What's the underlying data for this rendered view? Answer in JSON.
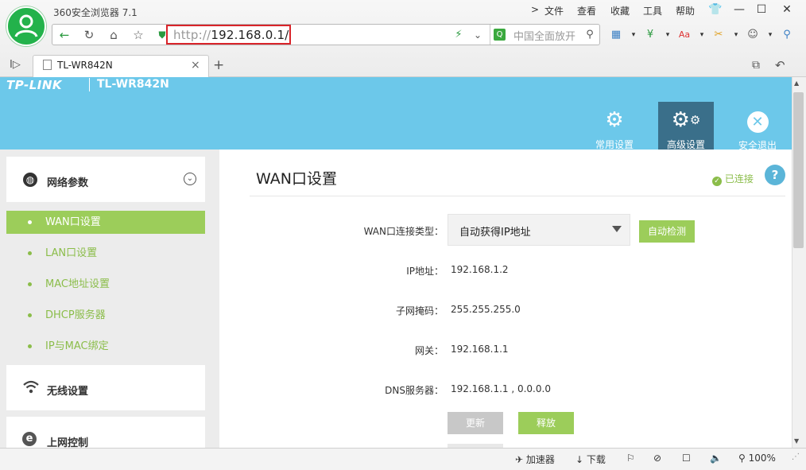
{
  "browser": {
    "app_title": "360安全浏览器 7.1",
    "menu": [
      "文件",
      "查看",
      "收藏",
      "工具",
      "帮助"
    ],
    "url_prefix": "http://",
    "url_host": "192.168.0.1/",
    "search_placeholder": "中国全面放开",
    "tab_title": "TL-WR842N",
    "tab_close": "×",
    "new_tab": "+",
    "status": {
      "accelerator": "加速器",
      "download": "下载",
      "zoom": "100%"
    }
  },
  "router": {
    "brand": "TP-LINK",
    "model": "TL-WR842N",
    "header_buttons": [
      {
        "label": "常用设置",
        "icon": "gear-icon"
      },
      {
        "label": "高级设置",
        "icon": "gears-icon"
      },
      {
        "label": "安全退出",
        "icon": "close-circle-icon"
      }
    ],
    "sidebar": {
      "sections": [
        {
          "label": "网络参数",
          "icon": "globe-icon"
        },
        {
          "label": "无线设置",
          "icon": "wifi-icon"
        },
        {
          "label": "上网控制",
          "icon": "ie-icon"
        }
      ],
      "subitems": [
        "WAN口设置",
        "LAN口设置",
        "MAC地址设置",
        "DHCP服务器",
        "IP与MAC绑定"
      ]
    },
    "main": {
      "title": "WAN口设置",
      "status": "已连接",
      "help": "?",
      "wan_type_label": "WAN口连接类型：",
      "wan_type_value": "自动获得IP地址",
      "detect_button": "自动检测",
      "ip_label": "IP地址：",
      "ip_value": "192.168.1.2",
      "mask_label": "子网掩码：",
      "mask_value": "255.255.255.0",
      "gateway_label": "网关：",
      "gateway_value": "192.168.1.1",
      "dns_label": "DNS服务器：",
      "dns_value": "192.168.1.1 , 0.0.0.0",
      "renew_button": "更新",
      "release_button": "释放"
    },
    "colors": {
      "header_bg": "#6cc8ea",
      "accent_green": "#9ccd5a",
      "active_header_btn": "#3a6f8a"
    }
  }
}
